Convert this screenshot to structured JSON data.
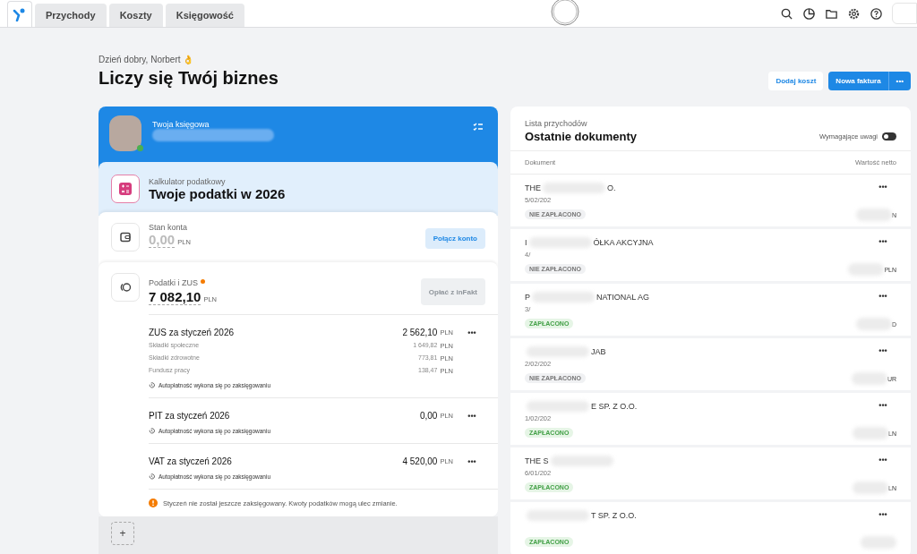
{
  "tabs": [
    {
      "label": "Przychody",
      "selected": false
    },
    {
      "label": "Koszty",
      "selected": false
    },
    {
      "label": "Księgowość",
      "selected": false
    }
  ],
  "greeting": "Dzień dobry, Norbert 👌",
  "title": "Liczy się Twój biznes",
  "actions": {
    "secondary": "Dodaj koszt",
    "primary": "Nowa faktura",
    "more": "•••"
  },
  "accountant": {
    "label": "Twoja księgowa",
    "online": true
  },
  "calculator": {
    "label": "Kalkulator podatkowy",
    "title": "Twoje podatki w 2026"
  },
  "balance": {
    "label": "Stan konta",
    "amount": "0,00",
    "currency": "PLN",
    "button": "Połącz konto"
  },
  "taxes": {
    "label": "Podatki i ZUS",
    "alert": true,
    "amount": "7 082,10",
    "currency": "PLN",
    "button": "Opłać z inFakt",
    "button_disabled": true,
    "items": [
      {
        "title": "ZUS za styczeń 2026",
        "amount": "2 562,10",
        "currency": "PLN",
        "more": "•••",
        "details": [
          {
            "label": "Składki społeczne",
            "amount": "1 649,82",
            "currency": "PLN"
          },
          {
            "label": "Składki zdrowotne",
            "amount": "773,81",
            "currency": "PLN"
          },
          {
            "label": "Fundusz pracy",
            "amount": "138,47",
            "currency": "PLN"
          }
        ],
        "note": "Autopłatność wykona się po zaksięgowaniu"
      },
      {
        "title": "PIT za styczeń 2026",
        "amount": "0,00",
        "currency": "PLN",
        "more": "•••",
        "note": "Autopłatność wykona się po zaksięgowaniu"
      },
      {
        "title": "VAT za styczeń 2026",
        "amount": "4 520,00",
        "currency": "PLN",
        "more": "•••",
        "note": "Autopłatność wykona się po zaksięgowaniu"
      }
    ],
    "warning": "Styczeń nie został jeszcze zaksięgowany. Kwoty podatków mogą ulec zmianie.",
    "add": "+"
  },
  "documents": {
    "label": "Lista przychodów",
    "title": "Ostatnie dokumenty",
    "filter": {
      "label": "Wymagające uwagi",
      "on": false
    },
    "columns": [
      "Dokument",
      "Wartość netto"
    ],
    "rows": [
      {
        "name_start": "THE",
        "name_end": "O.",
        "date": "5/02/202",
        "status": "NIE ZAPŁACONO",
        "paid": false,
        "value": "N",
        "more": "•••"
      },
      {
        "name_start": "I",
        "name_end": "ÓŁKA AKCYJNA",
        "date": "4/",
        "status": "NIE ZAPŁACONO",
        "paid": false,
        "value": "PLN",
        "more": "•••"
      },
      {
        "name_start": "P",
        "name_end": "NATIONAL AG",
        "date": "3/",
        "status": "ZAPŁACONO",
        "paid": true,
        "value": "D",
        "more": "•••"
      },
      {
        "name_start": "",
        "name_end": "JAB",
        "date": "2/02/202",
        "status": "NIE ZAPŁACONO",
        "paid": false,
        "value": "UR",
        "more": "•••"
      },
      {
        "name_start": "",
        "name_end": "E SP. Z O.O.",
        "date": "1/02/202",
        "status": "ZAPŁACONO",
        "paid": true,
        "value": "LN",
        "more": "•••"
      },
      {
        "name_start": "THE S",
        "name_end": "",
        "date": "6/01/202",
        "status": "ZAPŁACONO",
        "paid": true,
        "value": "LN",
        "more": "•••"
      },
      {
        "name_start": "",
        "name_end": "T SP. Z O.O.",
        "date": "",
        "status": "ZAPŁACONO",
        "paid": true,
        "value": "",
        "more": "•••"
      }
    ]
  }
}
